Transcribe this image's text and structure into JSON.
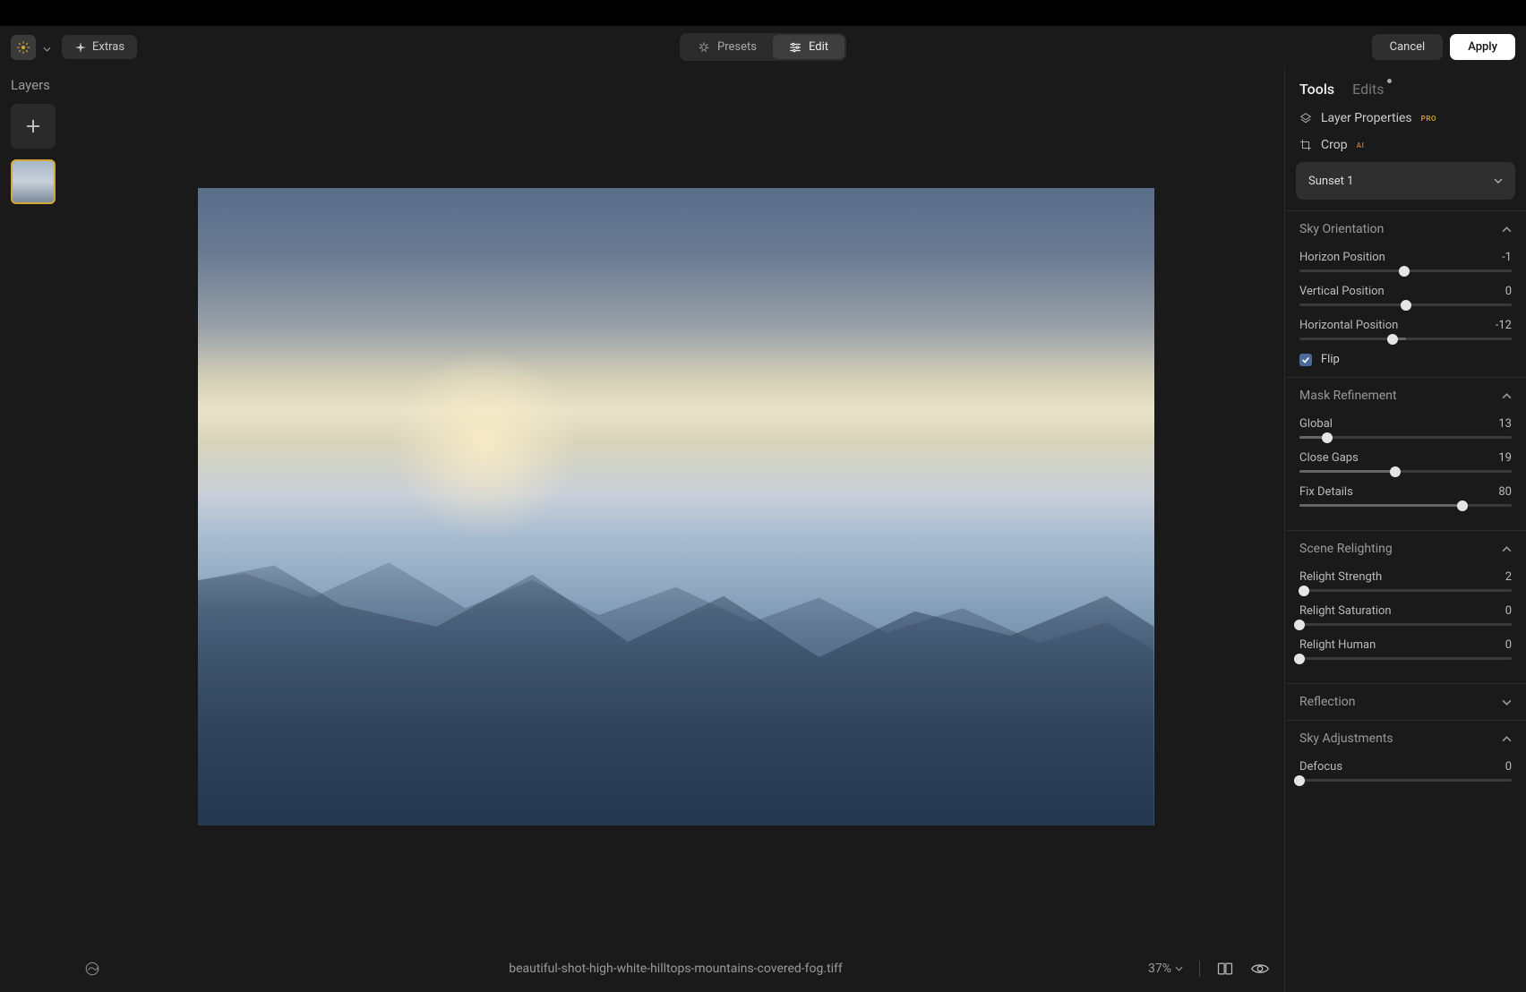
{
  "topbar": {
    "extras_label": "Extras",
    "presets_label": "Presets",
    "edit_label": "Edit",
    "cancel_label": "Cancel",
    "apply_label": "Apply"
  },
  "left": {
    "layers_title": "Layers"
  },
  "bottombar": {
    "filename": "beautiful-shot-high-white-hilltops-mountains-covered-fog.tiff",
    "zoom": "37%"
  },
  "right": {
    "tabs": {
      "tools": "Tools",
      "edits": "Edits"
    },
    "layer_properties": "Layer Properties",
    "layer_properties_badge": "PRO",
    "crop": "Crop",
    "crop_badge": "AI",
    "preset_selected": "Sunset 1",
    "sections": {
      "sky_orientation": {
        "title": "Sky Orientation",
        "expanded": true,
        "params": [
          {
            "label": "Horizon Position",
            "value": "-1",
            "pos": 49.5,
            "bipolar": true
          },
          {
            "label": "Vertical Position",
            "value": "0",
            "pos": 50,
            "bipolar": true
          },
          {
            "label": "Horizontal Position",
            "value": "-12",
            "pos": 44,
            "bipolar": true
          }
        ],
        "flip_label": "Flip",
        "flip_checked": true
      },
      "mask_refinement": {
        "title": "Mask Refinement",
        "expanded": true,
        "params": [
          {
            "label": "Global",
            "value": "13",
            "pos": 13
          },
          {
            "label": "Close Gaps",
            "value": "19",
            "pos": 45
          },
          {
            "label": "Fix Details",
            "value": "80",
            "pos": 77
          }
        ]
      },
      "scene_relighting": {
        "title": "Scene Relighting",
        "expanded": true,
        "params": [
          {
            "label": "Relight Strength",
            "value": "2",
            "pos": 2
          },
          {
            "label": "Relight Saturation",
            "value": "0",
            "pos": 0
          },
          {
            "label": "Relight Human",
            "value": "0",
            "pos": 0
          }
        ]
      },
      "reflection": {
        "title": "Reflection",
        "expanded": false
      },
      "sky_adjustments": {
        "title": "Sky Adjustments",
        "expanded": true,
        "params": [
          {
            "label": "Defocus",
            "value": "0",
            "pos": 0
          }
        ]
      }
    }
  }
}
